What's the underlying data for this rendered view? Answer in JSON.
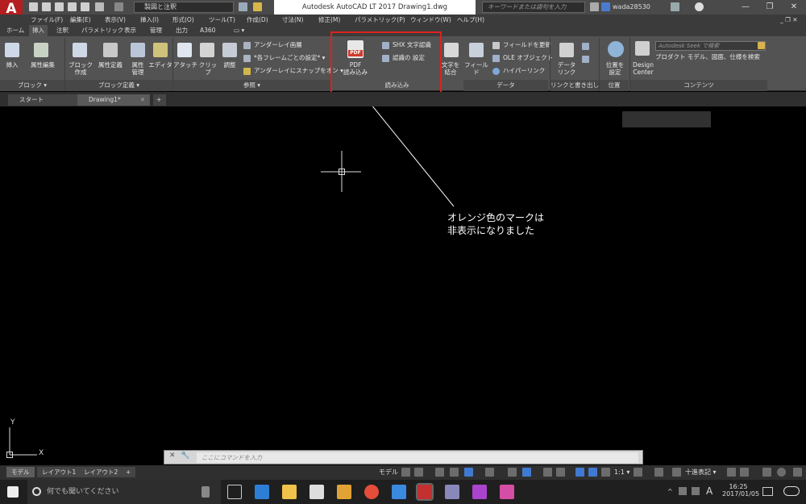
{
  "title_bar": {
    "workspace": "製図と注釈",
    "document_title": "Autodesk AutoCAD LT 2017    Drawing1.dwg",
    "search_placeholder": "キーワードまたは語句を入力",
    "user": "wada28530",
    "logo_sub": "LT"
  },
  "menus": [
    "ファイル(F)",
    "編集(E)",
    "表示(V)",
    "挿入(I)",
    "形式(O)",
    "ツール(T)",
    "作成(D)",
    "寸法(N)",
    "修正(M)",
    "パラメトリック(P)",
    "ウィンドウ(W)",
    "ヘルプ(H)"
  ],
  "ribbon_tabs": [
    "ホーム",
    "挿入",
    "注釈",
    "パラメトリック",
    "表示",
    "管理",
    "出力",
    "A360"
  ],
  "ribbon": {
    "block": {
      "insert": "挿入",
      "attr_edit": "属性編集",
      "label": "ブロック ▾"
    },
    "block_def": {
      "create": "ブロック\n作成",
      "attr_def": "属性定義",
      "attr_manage": "属性\n管理",
      "editor": "エディタ",
      "label": "ブロック定義 ▾"
    },
    "reference": {
      "attach": "アタッチ",
      "clip": "クリップ",
      "adjust": "調整",
      "underlay_layer": "アンダーレイ画層",
      "frame": "*各フレームごとの設定* ▾",
      "snap": "アンダーレイにスナップをオン ▾",
      "label": "参照 ▾"
    },
    "import": {
      "pdf": "PDF\n読み込み",
      "pdf_badge": "PDF",
      "shx": "SHX 文字認識",
      "shx_settings": "認識の 設定",
      "label": "読み込み"
    },
    "text_combine": "文字を\n結合",
    "data": {
      "field": "フィールド",
      "field_update": "フィールドを更新",
      "ole": "OLE オブジェクト",
      "hyperlink": "ハイパーリンク",
      "label": "データ"
    },
    "link": {
      "data_link": "データ\nリンク",
      "label": "リンクと書き出し"
    },
    "location": {
      "set": "位置を\n設定",
      "label": "位置"
    },
    "content": {
      "design_center": "Design\nCenter",
      "seek_placeholder": "Autodesk Seek で検索",
      "seek_desc": "プロダクト モデル、図面、仕様を検索",
      "label": "コンテンツ"
    }
  },
  "file_tabs": {
    "start": "スタート",
    "drawing": "Drawing1*"
  },
  "annotation": "オレンジ色のマークは\n非表示になりました",
  "command_placeholder": "ここにコマンドを入力",
  "status": {
    "model_tab": "モデル",
    "layout1": "レイアウト1",
    "layout2": "レイアウト2",
    "model": "モデル",
    "scale": "1:1 ▾",
    "units": "十進表記 ▾"
  },
  "taskbar": {
    "search": "何でも聞いてください",
    "time": "16:25",
    "date": "2017/01/05",
    "ime": "A"
  },
  "colors": {
    "highlight_box": "#e0201e",
    "logo_red": "#b41e1e",
    "pdf_red": "#d23a2c"
  }
}
